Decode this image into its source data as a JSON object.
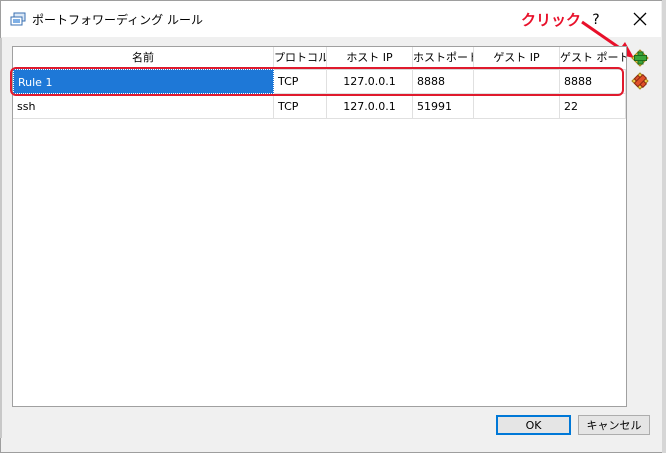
{
  "window": {
    "title": "ポートフォワーディング ルール",
    "help_label": "?"
  },
  "annotation": {
    "text": "クリック",
    "color": "#e8102a"
  },
  "table": {
    "columns": [
      "名前",
      "プロトコル",
      "ホスト IP",
      "ホストポート",
      "ゲスト IP",
      "ゲスト ポート"
    ],
    "rows": [
      [
        "Rule 1",
        "TCP",
        "127.0.0.1",
        "8888",
        "",
        "8888"
      ],
      [
        "ssh",
        "TCP",
        "127.0.0.1",
        "51991",
        "",
        "22"
      ]
    ],
    "selected_row": 0
  },
  "side_buttons": {
    "add": "add-rule-icon",
    "remove": "remove-rule-icon"
  },
  "footer": {
    "ok_label": "OK",
    "cancel_label": "キャンセル"
  },
  "colors": {
    "selection": "#1e78d7",
    "highlight": "#e01a2d",
    "accent": "#0078d7"
  }
}
